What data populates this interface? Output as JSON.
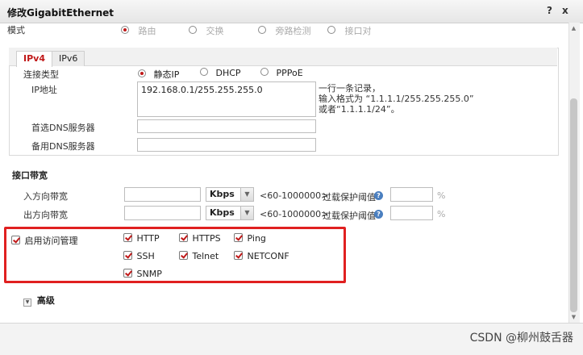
{
  "dialog": {
    "title": "修改GigabitEthernet",
    "help": "?",
    "close": "x"
  },
  "mode": {
    "label": "模式",
    "options": [
      {
        "label": "路由",
        "selected": true
      },
      {
        "label": "交换",
        "selected": false
      },
      {
        "label": "旁路检测",
        "selected": false
      },
      {
        "label": "接口对",
        "selected": false
      }
    ]
  },
  "tabs": [
    {
      "label": "IPv4",
      "active": true
    },
    {
      "label": "IPv6",
      "active": false
    }
  ],
  "ipv4": {
    "conn_type_label": "连接类型",
    "conn_types": [
      {
        "label": "静态IP",
        "selected": true
      },
      {
        "label": "DHCP",
        "selected": false
      },
      {
        "label": "PPPoE",
        "selected": false
      }
    ],
    "ip_label": "IP地址",
    "ip_value": "192.168.0.1/255.255.255.0",
    "ip_hint": [
      "一行一条记录，",
      "输入格式为 “1.1.1.1/255.255.255.0”",
      "或者“1.1.1.1/24”。"
    ],
    "dns1_label": "首选DNS服务器",
    "dns1_value": "",
    "dns2_label": "备用DNS服务器",
    "dns2_value": ""
  },
  "bandwidth": {
    "title": "接口带宽",
    "rows": [
      {
        "label": "入方向带宽",
        "value": "",
        "unit": "Kbps",
        "range": "<60-1000000>",
        "threshold_label": "过载保护阈值",
        "threshold_value": "",
        "pct": "%"
      },
      {
        "label": "出方向带宽",
        "value": "",
        "unit": "Kbps",
        "range": "<60-1000000>",
        "threshold_label": "过载保护阈值",
        "threshold_value": "",
        "pct": "%"
      }
    ]
  },
  "access": {
    "enable_label": "启用访问管理",
    "enabled": true,
    "services": [
      {
        "label": "HTTP",
        "checked": true
      },
      {
        "label": "HTTPS",
        "checked": true
      },
      {
        "label": "Ping",
        "checked": true
      },
      {
        "label": "SSH",
        "checked": true
      },
      {
        "label": "Telnet",
        "checked": true
      },
      {
        "label": "NETCONF",
        "checked": true
      },
      {
        "label": "SNMP",
        "checked": true
      }
    ]
  },
  "advanced": {
    "label": "高级"
  },
  "watermark": "CSDN @柳州鼓舌器"
}
